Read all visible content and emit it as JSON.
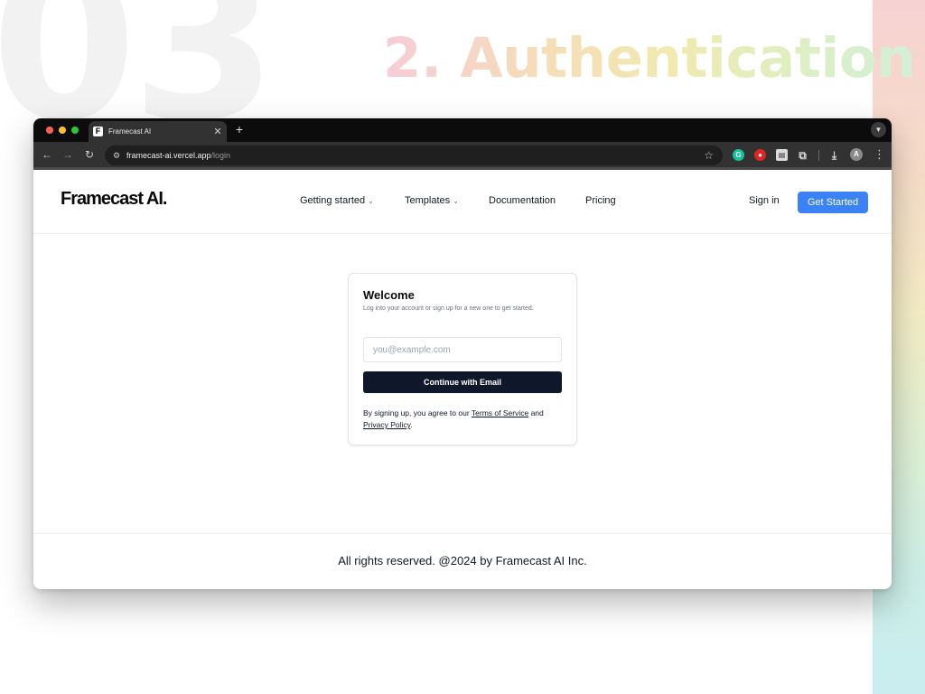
{
  "slide": {
    "number": "03",
    "section_title": "2. Authentication"
  },
  "browser": {
    "tab_title": "Framecast AI",
    "favicon_letter": "F",
    "url_host": "framecast-ai.vercel.app",
    "url_path": "/login",
    "extension_letters": {
      "grammarly": "G",
      "avatar": "A"
    }
  },
  "site": {
    "logo": "Framecast AI.",
    "nav": [
      {
        "label": "Getting started",
        "dropdown": true
      },
      {
        "label": "Templates",
        "dropdown": true
      },
      {
        "label": "Documentation",
        "dropdown": false
      },
      {
        "label": "Pricing",
        "dropdown": false
      }
    ],
    "sign_in": "Sign in",
    "get_started": "Get Started",
    "accent_color": "#3b82f6"
  },
  "login_card": {
    "title": "Welcome",
    "subtitle": "Log into your account or sign up for a new one to get started.",
    "email_placeholder": "you@example.com",
    "email_value": "",
    "continue_label": "Continue with Email",
    "legal_prefix": "By signing up, you agree to our",
    "terms_link": "Terms of Service",
    "legal_and": "and",
    "privacy_link": "Privacy Policy",
    "legal_end": "."
  },
  "footer": {
    "text": "All rights reserved. @2024 by Framecast AI Inc."
  },
  "icons": [
    "back-arrow-icon",
    "forward-arrow-icon",
    "reload-icon",
    "site-info-icon",
    "star-icon",
    "grammarly-icon",
    "extension-red-icon",
    "extension-note-icon",
    "puzzle-icon",
    "download-icon",
    "profile-avatar-icon",
    "kebab-menu-icon",
    "chevron-down-icon",
    "close-icon",
    "plus-icon"
  ]
}
